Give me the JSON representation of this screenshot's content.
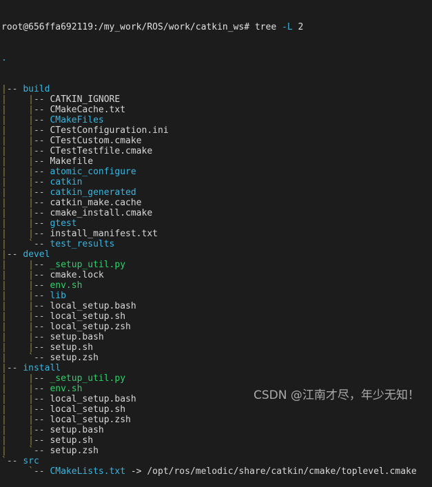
{
  "terminal": {
    "background_color": "#1c1c1c",
    "prompt": {
      "user_host_path": "root@656ffa692119:/my_work/ROS/work/catkin_ws# ",
      "command": "tree",
      "flag": "-L",
      "flag_value": "2"
    },
    "root_marker": ".",
    "colors": {
      "directory": "#37b6e0",
      "file": "#d8d8d8",
      "executable": "#2fd06a",
      "symlink": "#37b6e0",
      "connector_pipe": "#9a8a3a",
      "connector_dash": "#b9b9b9",
      "flag": "#37b6e0"
    },
    "connectors": {
      "branch": "|--",
      "last": "`--",
      "vertical": "|"
    },
    "tree": [
      {
        "indent": 0,
        "last": false,
        "name": "build",
        "type": "directory"
      },
      {
        "indent": 1,
        "last": false,
        "name": "CATKIN_IGNORE",
        "type": "file"
      },
      {
        "indent": 1,
        "last": false,
        "name": "CMakeCache.txt",
        "type": "file"
      },
      {
        "indent": 1,
        "last": false,
        "name": "CMakeFiles",
        "type": "directory"
      },
      {
        "indent": 1,
        "last": false,
        "name": "CTestConfiguration.ini",
        "type": "file"
      },
      {
        "indent": 1,
        "last": false,
        "name": "CTestCustom.cmake",
        "type": "file"
      },
      {
        "indent": 1,
        "last": false,
        "name": "CTestTestfile.cmake",
        "type": "file"
      },
      {
        "indent": 1,
        "last": false,
        "name": "Makefile",
        "type": "file"
      },
      {
        "indent": 1,
        "last": false,
        "name": "atomic_configure",
        "type": "directory"
      },
      {
        "indent": 1,
        "last": false,
        "name": "catkin",
        "type": "directory"
      },
      {
        "indent": 1,
        "last": false,
        "name": "catkin_generated",
        "type": "directory"
      },
      {
        "indent": 1,
        "last": false,
        "name": "catkin_make.cache",
        "type": "file"
      },
      {
        "indent": 1,
        "last": false,
        "name": "cmake_install.cmake",
        "type": "file"
      },
      {
        "indent": 1,
        "last": false,
        "name": "gtest",
        "type": "directory"
      },
      {
        "indent": 1,
        "last": false,
        "name": "install_manifest.txt",
        "type": "file"
      },
      {
        "indent": 1,
        "last": true,
        "name": "test_results",
        "type": "directory"
      },
      {
        "indent": 0,
        "last": false,
        "name": "devel",
        "type": "directory"
      },
      {
        "indent": 1,
        "last": false,
        "name": "_setup_util.py",
        "type": "executable"
      },
      {
        "indent": 1,
        "last": false,
        "name": "cmake.lock",
        "type": "file"
      },
      {
        "indent": 1,
        "last": false,
        "name": "env.sh",
        "type": "executable"
      },
      {
        "indent": 1,
        "last": false,
        "name": "lib",
        "type": "directory"
      },
      {
        "indent": 1,
        "last": false,
        "name": "local_setup.bash",
        "type": "file"
      },
      {
        "indent": 1,
        "last": false,
        "name": "local_setup.sh",
        "type": "file"
      },
      {
        "indent": 1,
        "last": false,
        "name": "local_setup.zsh",
        "type": "file"
      },
      {
        "indent": 1,
        "last": false,
        "name": "setup.bash",
        "type": "file"
      },
      {
        "indent": 1,
        "last": false,
        "name": "setup.sh",
        "type": "file"
      },
      {
        "indent": 1,
        "last": true,
        "name": "setup.zsh",
        "type": "file"
      },
      {
        "indent": 0,
        "last": false,
        "name": "install",
        "type": "directory"
      },
      {
        "indent": 1,
        "last": false,
        "name": "_setup_util.py",
        "type": "executable"
      },
      {
        "indent": 1,
        "last": false,
        "name": "env.sh",
        "type": "executable"
      },
      {
        "indent": 1,
        "last": false,
        "name": "local_setup.bash",
        "type": "file"
      },
      {
        "indent": 1,
        "last": false,
        "name": "local_setup.sh",
        "type": "file"
      },
      {
        "indent": 1,
        "last": false,
        "name": "local_setup.zsh",
        "type": "file"
      },
      {
        "indent": 1,
        "last": false,
        "name": "setup.bash",
        "type": "file"
      },
      {
        "indent": 1,
        "last": false,
        "name": "setup.sh",
        "type": "file"
      },
      {
        "indent": 1,
        "last": true,
        "name": "setup.zsh",
        "type": "file"
      },
      {
        "indent": 0,
        "last": true,
        "name": "src",
        "type": "directory"
      },
      {
        "indent": 1,
        "last": true,
        "name": "CMakeLists.txt",
        "type": "symlink",
        "link_arrow": " -> ",
        "link_target": "/opt/ros/melodic/share/catkin/cmake/toplevel.cmake"
      }
    ]
  },
  "watermark": {
    "text": "CSDN @江南才尽，年少无知！"
  }
}
